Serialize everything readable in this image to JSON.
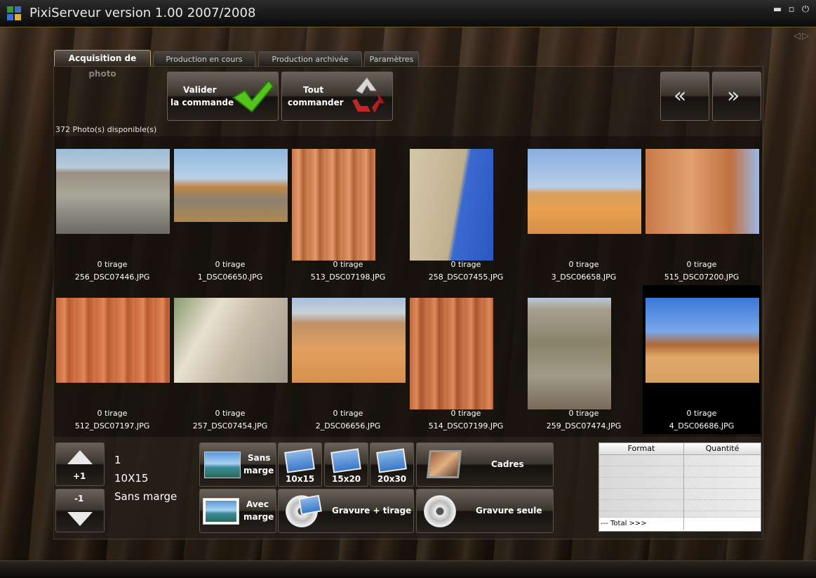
{
  "window": {
    "title": "PixiServeur version 1.00 2007/2008",
    "controls": [
      "minimize-icon",
      "maximize-icon",
      "power-icon"
    ]
  },
  "tabs": [
    {
      "label": "Acquisition de photo",
      "active": true
    },
    {
      "label": "Production en cours",
      "active": false
    },
    {
      "label": "Production archivée",
      "active": false
    },
    {
      "label": "Paramètres",
      "active": false
    }
  ],
  "toolbar": {
    "validate_line1": "Valider",
    "validate_line2": "la commande",
    "all_line1": "Tout",
    "all_line2": "commander"
  },
  "available": "372 Photo(s) disponible(s)",
  "photos": [
    {
      "tirage": "0 tirage",
      "name": "256_DSC07446.JPG"
    },
    {
      "tirage": "0 tirage",
      "name": "1_DSC06650.JPG"
    },
    {
      "tirage": "0 tirage",
      "name": "513_DSC07198.JPG"
    },
    {
      "tirage": "0 tirage",
      "name": "258_DSC07455.JPG"
    },
    {
      "tirage": "0 tirage",
      "name": "3_DSC06658.JPG"
    },
    {
      "tirage": "0 tirage",
      "name": "515_DSC07200.JPG"
    },
    {
      "tirage": "0 tirage",
      "name": "512_DSC07197.JPG"
    },
    {
      "tirage": "0 tirage",
      "name": "257_DSC07454.JPG"
    },
    {
      "tirage": "0 tirage",
      "name": "2_DSC06656.JPG"
    },
    {
      "tirage": "0 tirage",
      "name": "514_DSC07199.JPG"
    },
    {
      "tirage": "0 tirage",
      "name": "259_DSC07474.JPG"
    },
    {
      "tirage": "0 tirage",
      "name": "4_DSC06686.JPG",
      "selected": true
    }
  ],
  "qty": {
    "plus": "+1",
    "minus": "-1",
    "count": "1",
    "format": "10X15",
    "border": "Sans marge"
  },
  "options": {
    "sans_marge_1": "Sans",
    "sans_marge_2": "marge",
    "avec_marge_1": "Avec",
    "avec_marge_2": "marge",
    "f1": "10x15",
    "f2": "15x20",
    "f3": "20x30",
    "cadres": "Cadres",
    "gravure_tirage": "Gravure + tirage",
    "gravure_seule": "Gravure seule"
  },
  "summary": {
    "col_format": "Format",
    "col_qty": "Quantité",
    "total": "--- Total >>>"
  }
}
